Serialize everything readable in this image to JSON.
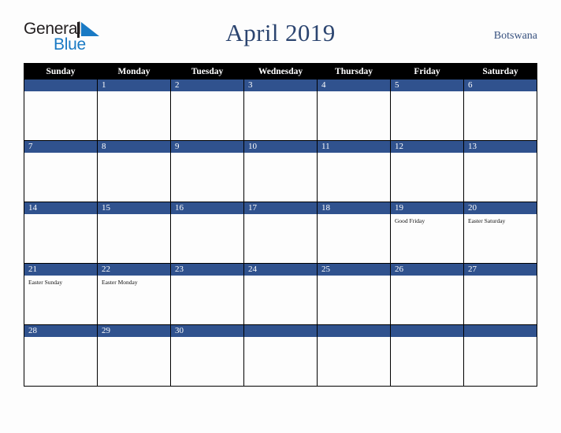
{
  "brand": {
    "name_part1": "General",
    "name_part2": "Blue",
    "logo_icon": "blue-triangle-logo",
    "color_primary": "#1a7ac4",
    "color_text": "#231f20"
  },
  "header": {
    "title": "April 2019",
    "region": "Botswana",
    "title_color": "#2c4570",
    "region_color": "#36507e"
  },
  "calendar": {
    "month": "April",
    "year": "2019",
    "accent_color": "#30528e",
    "header_background": "#000000",
    "weekday_headers": [
      "Sunday",
      "Monday",
      "Tuesday",
      "Wednesday",
      "Thursday",
      "Friday",
      "Saturday"
    ],
    "weeks": [
      [
        {
          "day": "",
          "event": ""
        },
        {
          "day": "1",
          "event": ""
        },
        {
          "day": "2",
          "event": ""
        },
        {
          "day": "3",
          "event": ""
        },
        {
          "day": "4",
          "event": ""
        },
        {
          "day": "5",
          "event": ""
        },
        {
          "day": "6",
          "event": ""
        }
      ],
      [
        {
          "day": "7",
          "event": ""
        },
        {
          "day": "8",
          "event": ""
        },
        {
          "day": "9",
          "event": ""
        },
        {
          "day": "10",
          "event": ""
        },
        {
          "day": "11",
          "event": ""
        },
        {
          "day": "12",
          "event": ""
        },
        {
          "day": "13",
          "event": ""
        }
      ],
      [
        {
          "day": "14",
          "event": ""
        },
        {
          "day": "15",
          "event": ""
        },
        {
          "day": "16",
          "event": ""
        },
        {
          "day": "17",
          "event": ""
        },
        {
          "day": "18",
          "event": ""
        },
        {
          "day": "19",
          "event": "Good Friday"
        },
        {
          "day": "20",
          "event": "Easter Saturday"
        }
      ],
      [
        {
          "day": "21",
          "event": "Easter Sunday"
        },
        {
          "day": "22",
          "event": "Easter Monday"
        },
        {
          "day": "23",
          "event": ""
        },
        {
          "day": "24",
          "event": ""
        },
        {
          "day": "25",
          "event": ""
        },
        {
          "day": "26",
          "event": ""
        },
        {
          "day": "27",
          "event": ""
        }
      ],
      [
        {
          "day": "28",
          "event": ""
        },
        {
          "day": "29",
          "event": ""
        },
        {
          "day": "30",
          "event": ""
        },
        {
          "day": "",
          "event": ""
        },
        {
          "day": "",
          "event": ""
        },
        {
          "day": "",
          "event": ""
        },
        {
          "day": "",
          "event": ""
        }
      ]
    ]
  }
}
